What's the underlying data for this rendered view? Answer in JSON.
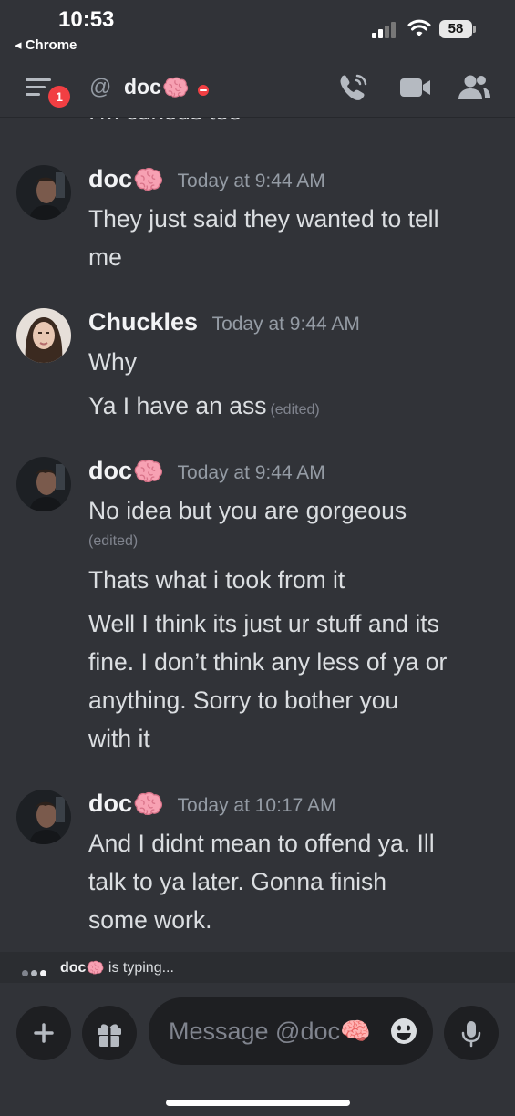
{
  "status_bar": {
    "time": "10:53",
    "back_label": "◂ Chrome",
    "battery": "58"
  },
  "header": {
    "unread_count": "1",
    "at_symbol": "@",
    "channel_name": "doc",
    "channel_emoji": "brain-icon",
    "status": "do-not-disturb"
  },
  "conversation": {
    "partial_previous_line": "I'm curious too",
    "messages": [
      {
        "author": "doc",
        "author_emoji": "brain-icon",
        "timestamp": "Today at 9:44 AM",
        "lines": [
          "They just said they wanted to tell",
          "me"
        ]
      },
      {
        "author": "Chuckles",
        "timestamp": "Today at 9:44 AM",
        "lines": [
          "Why",
          "Ya I have an ass"
        ],
        "edited_label": "(edited)"
      },
      {
        "author": "doc",
        "author_emoji": "brain-icon",
        "timestamp": "Today at 9:44 AM",
        "lines": [
          "No idea but you are gorgeous",
          "Thats what i took from it",
          "Well I think its just ur stuff and its",
          "fine. I don’t think any less of ya or",
          "anything. Sorry to bother you",
          "with it"
        ],
        "edited_label": "(edited)"
      },
      {
        "author": "doc",
        "author_emoji": "brain-icon",
        "timestamp": "Today at 10:17 AM",
        "lines": [
          "And I didnt mean to offend ya. Ill",
          "talk to ya later. Gonna finish",
          "some work."
        ]
      }
    ]
  },
  "typing_indicator": {
    "name": "doc",
    "text": "is typing..."
  },
  "composer": {
    "placeholder": "Message @doc🧠"
  },
  "colors": {
    "background": "#313338",
    "input_background": "#1e1f22",
    "text": "#dbdee1",
    "muted": "#949ba4",
    "badge_red": "#f23f43"
  }
}
